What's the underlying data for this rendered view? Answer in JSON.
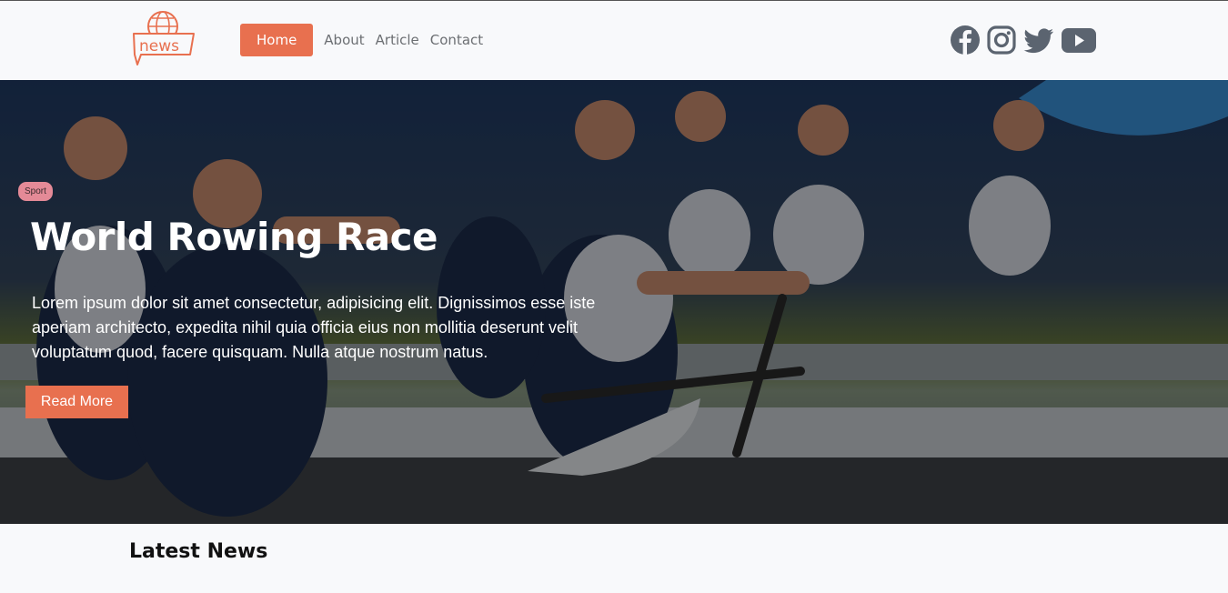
{
  "logo": {
    "text": "news",
    "color": "#e8704f"
  },
  "nav": {
    "items": [
      {
        "label": "Home",
        "active": true
      },
      {
        "label": "About",
        "active": false
      },
      {
        "label": "Article",
        "active": false
      },
      {
        "label": "Contact",
        "active": false
      }
    ]
  },
  "social": {
    "icons": [
      "facebook-icon",
      "instagram-icon",
      "twitter-icon",
      "youtube-icon"
    ],
    "color": "#5b6470"
  },
  "hero": {
    "category": "Sport",
    "title": "World Rowing Race",
    "description": "Lorem ipsum dolor sit amet consectetur, adipisicing elit. Dignissimos esse iste aperiam architecto, expedita nihil quia officia eius non mollitia deserunt velit voluptatum quod, facere quisquam. Nulla atque nostrum natus.",
    "button_label": "Read More",
    "accent": "#e8704f",
    "badge_color": "#e48a97"
  },
  "latest": {
    "heading": "Latest News"
  }
}
